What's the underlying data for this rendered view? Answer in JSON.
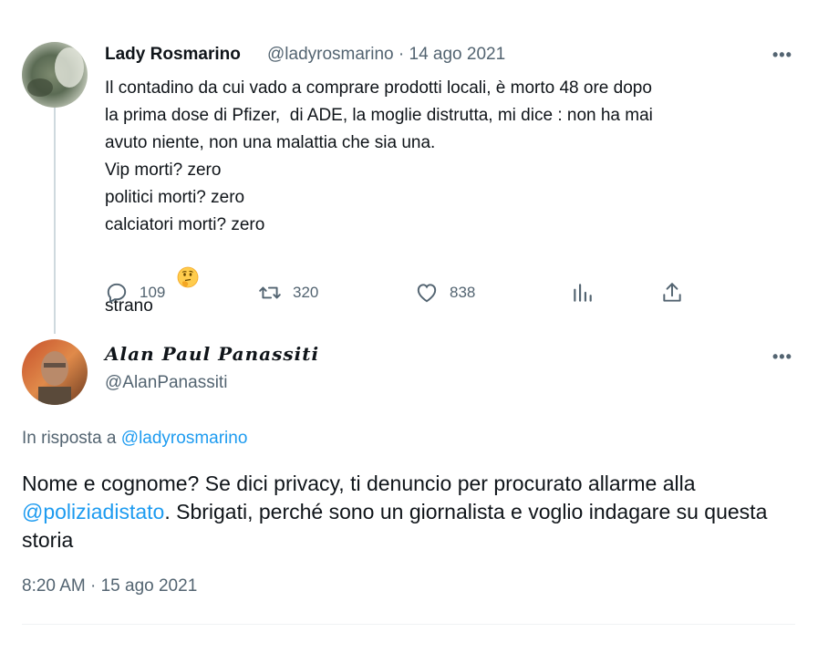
{
  "tweet1": {
    "author_name": "Lady Rosmarino",
    "handle_date": "@ladyrosmarino · 14 ago 2021",
    "more": "•••",
    "lines": [
      "Il contadino da cui vado a comprare prodotti locali, è morto 48 ore dopo",
      "la prima dose di Pfizer,  di ADE, la moglie distrutta, mi dice : non ha mai",
      "avuto niente, non una malattia che sia una.",
      "Vip morti? zero",
      "politici morti? zero",
      "calciatori morti? zero",
      "strano "
    ],
    "emoji_icon": "thinking-face-emoji",
    "actions": {
      "replies": "109",
      "retweets": "320",
      "likes": "838"
    }
  },
  "tweet2": {
    "author_name": "Alan Paul Panassiti",
    "handle": "@AlanPanassiti",
    "more": "•••",
    "reply_prefix": "In risposta a ",
    "reply_handle": "@ladyrosmarino",
    "text_part1": "Nome e cognome? Se dici privacy, ti denuncio per procurato allarme alla ",
    "mention": "@poliziadistato",
    "text_part2": ". Sbrigati, perché sono un giornalista e voglio indagare su questa storia",
    "meta": "8:20 AM · 15 ago 2021"
  },
  "colors": {
    "text": "#0f1419",
    "secondary": "#536471",
    "link": "#1d9bf0",
    "thread_line": "#cfd9de"
  }
}
